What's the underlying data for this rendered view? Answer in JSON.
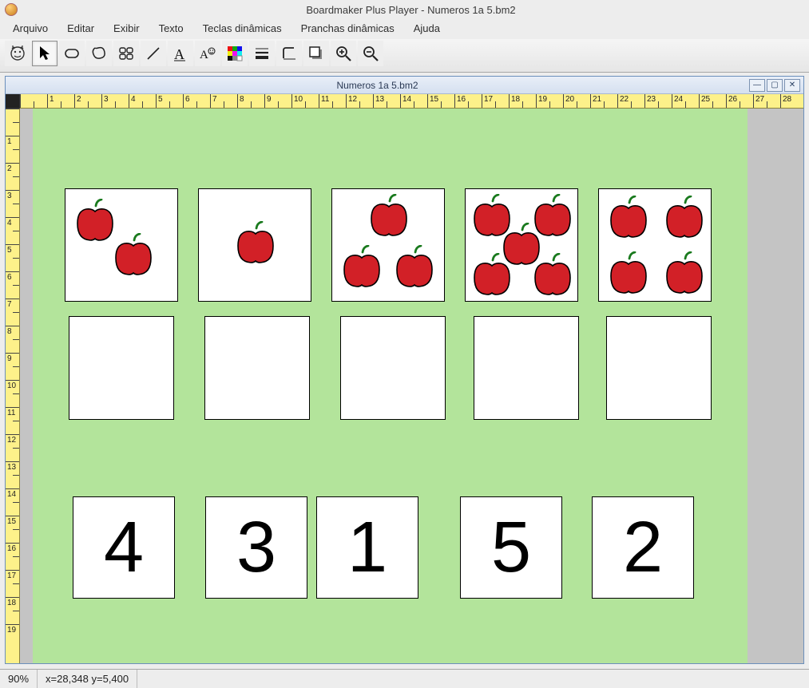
{
  "app": {
    "title": "Boardmaker Plus Player - Numeros 1a 5.bm2"
  },
  "menu": {
    "arquivo": "Arquivo",
    "editar": "Editar",
    "exibir": "Exibir",
    "texto": "Texto",
    "teclas": "Teclas dinâmicas",
    "pranchas": "Pranchas dinâmicas",
    "ajuda": "Ajuda"
  },
  "doc": {
    "title": "Numeros 1a 5.bm2"
  },
  "cards": {
    "apple_counts": [
      2,
      1,
      3,
      5,
      4
    ],
    "numbers": [
      "4",
      "3",
      "1",
      "5",
      "2"
    ]
  },
  "status": {
    "zoom": "90%",
    "coords": "x=28,348   y=5,400"
  },
  "ruler": {
    "hmax": 28,
    "vmax": 19
  }
}
